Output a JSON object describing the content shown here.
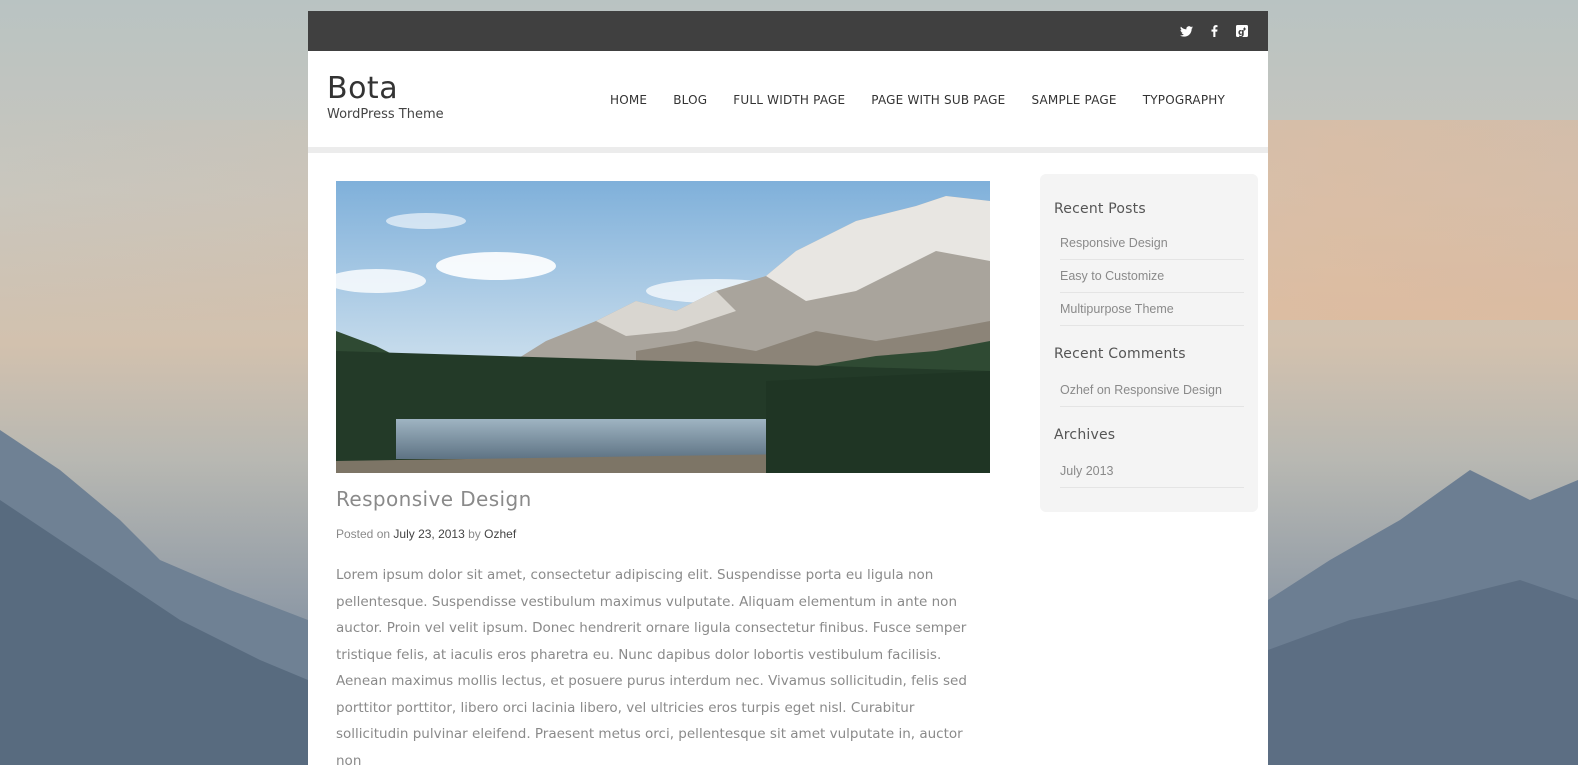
{
  "site": {
    "title": "Bota",
    "description": "WordPress Theme"
  },
  "social": {
    "icons": [
      "twitter-icon",
      "facebook-icon",
      "google-plus-icon"
    ]
  },
  "nav": {
    "items": [
      "HOME",
      "BLOG",
      "FULL WIDTH PAGE",
      "PAGE WITH SUB PAGE",
      "SAMPLE PAGE",
      "TYPOGRAPHY"
    ]
  },
  "post": {
    "title": "Responsive Design",
    "meta": {
      "posted_on": "Posted on",
      "date": "July 23, 2013",
      "by": "by",
      "author": "Ozhef"
    },
    "body": "Lorem ipsum dolor sit amet, consectetur adipiscing elit. Suspendisse porta eu ligula non pellentesque. Suspendisse vestibulum maximus vulputate. Aliquam elementum in ante non auctor. Proin vel velit ipsum. Donec hendrerit ornare ligula consectetur finibus. Fusce semper tristique felis, at iaculis eros pharetra eu. Nunc dapibus dolor lobortis vestibulum facilisis. Aenean maximus mollis lectus, et posuere purus interdum nec. Vivamus sollicitudin, felis sed porttitor porttitor, libero orci lacinia libero, vel ultricies eros turpis eget nisl. Curabitur sollicitudin pulvinar eleifend. Praesent metus orci, pellentesque sit amet vulputate in, auctor non"
  },
  "sidebar": {
    "recent_posts": {
      "title": "Recent Posts",
      "items": [
        "Responsive Design",
        "Easy to Customize",
        "Multipurpose Theme"
      ]
    },
    "recent_comments": {
      "title": "Recent Comments",
      "items": [
        "Ozhef on Responsive Design"
      ]
    },
    "archives": {
      "title": "Archives",
      "items": [
        "July 2013"
      ]
    }
  },
  "colors": {
    "topbar": "#404040",
    "text_muted": "#8a8a8a",
    "sidebar_bg": "#f4f4f4"
  }
}
